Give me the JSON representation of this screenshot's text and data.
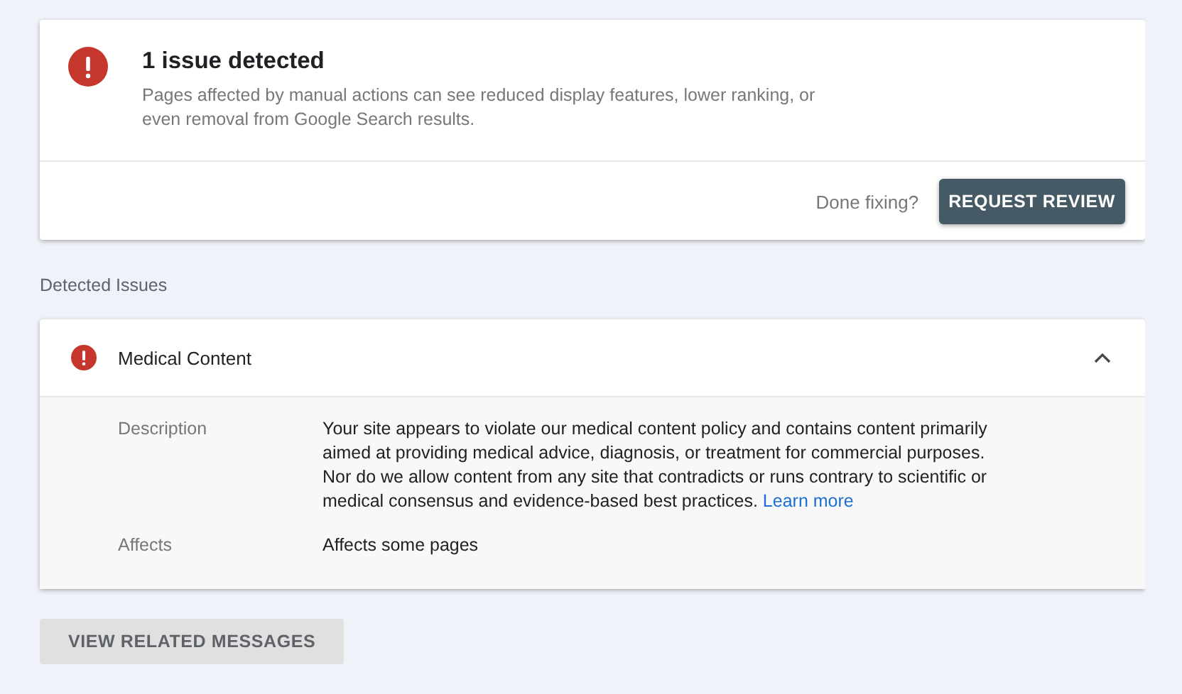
{
  "summary": {
    "title": "1 issue detected",
    "message": "Pages affected by manual actions can see reduced display features, lower ranking, or even removal from Google Search results.",
    "prompt": "Done fixing?",
    "button": "REQUEST REVIEW"
  },
  "section_label": "Detected Issues",
  "issues": [
    {
      "title": "Medical Content",
      "expanded": true,
      "details": [
        {
          "label": "Description",
          "text": "Your site appears to violate our medical content policy and contains content primarily aimed at providing medical advice, diagnosis, or treatment for commercial purposes. Nor do we allow content from any site that contradicts or runs contrary to scientific or medical consensus and evidence-based best practices.",
          "link": "Learn more"
        },
        {
          "label": "Affects",
          "text": "Affects some pages"
        }
      ]
    }
  ],
  "footer_button": "VIEW RELATED MESSAGES"
}
